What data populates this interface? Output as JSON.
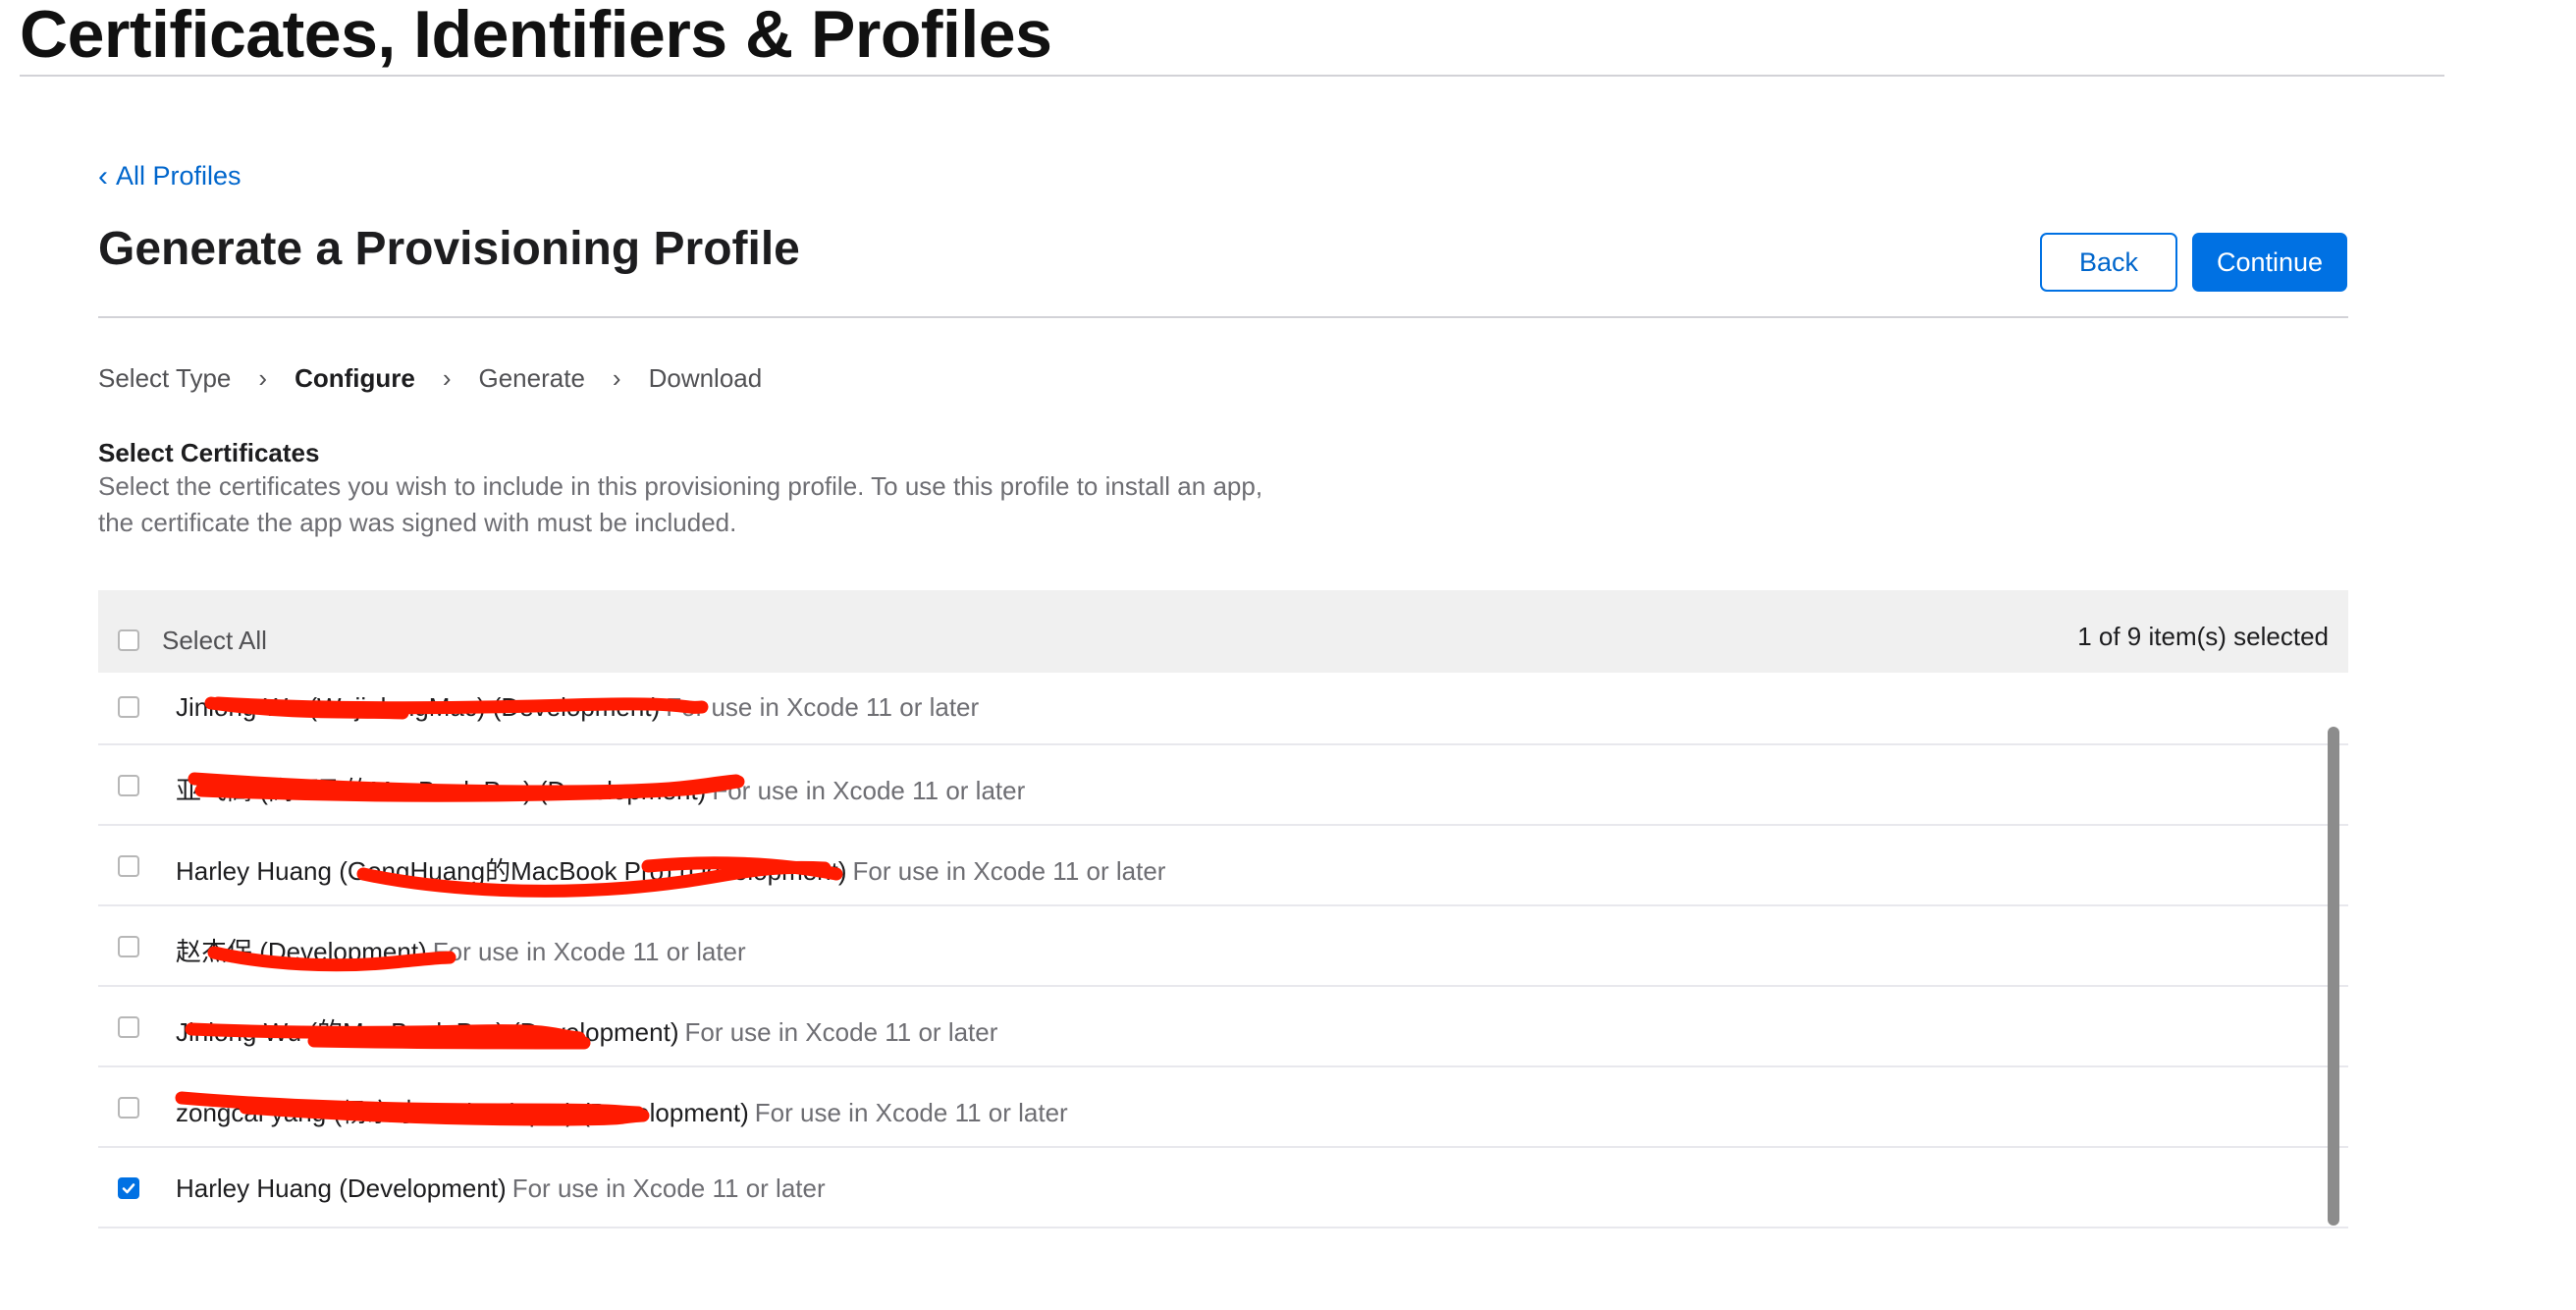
{
  "header": {
    "title": "Certificates, Identifiers & Profiles"
  },
  "nav": {
    "back_link": "All Profiles",
    "back_icon": "chevron-left-icon"
  },
  "page": {
    "title": "Generate a Provisioning Profile"
  },
  "buttons": {
    "back": "Back",
    "continue": "Continue"
  },
  "steps": [
    {
      "label": "Select Type",
      "active": false
    },
    {
      "label": "Configure",
      "active": true
    },
    {
      "label": "Generate",
      "active": false
    },
    {
      "label": "Download",
      "active": false
    }
  ],
  "step_separator_icon": "chevron-right-icon",
  "certificates": {
    "heading": "Select Certificates",
    "description_line1": "Select the certificates you wish to include in this provisioning profile. To use this profile to install an app,",
    "description_line2": "the certificate the app was signed with must be included.",
    "select_all": "Select All",
    "selected_count": "1 of 9 item(s) selected",
    "rows": [
      {
        "name": "Jinlong Wu (WujinlongMac) (Development)",
        "note": "For use in Xcode 11 or later",
        "checked": false
      },
      {
        "name": "亚飞高 (高亚飞的MacBook Pro) (Development)",
        "note": "For use in Xcode 11 or later",
        "checked": false
      },
      {
        "name": "Harley Huang (GongHuang的MacBook Pro) (Development)",
        "note": "For use in Xcode 11 or later",
        "checked": false
      },
      {
        "name": "赵杰保 (Development)",
        "note": "For use in Xcode 11 or later",
        "checked": false
      },
      {
        "name": "Jinlong Wu (的MacBook Pro) (Development)",
        "note": "For use in Xcode 11 or later",
        "checked": false
      },
      {
        "name": "zongcai yang (杨宗才Macbook pro) (Development)",
        "note": "For use in Xcode 11 or later",
        "checked": false
      },
      {
        "name": "Harley Huang (Development)",
        "note": "For use in Xcode 11 or later",
        "checked": true
      }
    ]
  },
  "colors": {
    "accent": "#0071e3",
    "redaction": "#ff1a00"
  }
}
